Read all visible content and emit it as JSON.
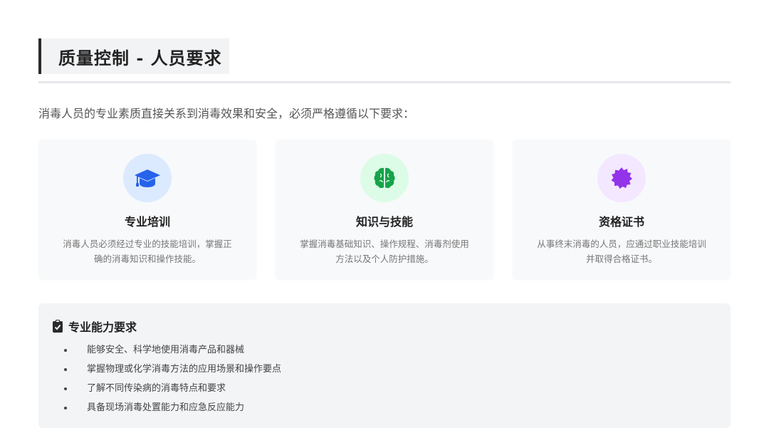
{
  "page": {
    "title": "质量控制 - 人员要求",
    "intro": "消毒人员的专业素质直接关系到消毒效果和安全，必须严格遵循以下要求："
  },
  "cards": [
    {
      "icon": "graduation-cap-icon",
      "icon_color": "#2563eb",
      "icon_bg": "#dbeafe",
      "title": "专业培训",
      "desc_line1": "消毒人员必须经过专业的技能培训，掌握正",
      "desc_line2": "确的消毒知识和操作技能。"
    },
    {
      "icon": "brain-icon",
      "icon_color": "#16a34a",
      "icon_bg": "#dcfce7",
      "title": "知识与技能",
      "desc_line1": "掌握消毒基础知识、操作规程、消毒剂使用",
      "desc_line2": "方法以及个人防护措施。"
    },
    {
      "icon": "certificate-badge-icon",
      "icon_color": "#9333ea",
      "icon_bg": "#f3e8ff",
      "title": "资格证书",
      "desc_line1": "从事终末消毒的人员，应通过职业技能培训",
      "desc_line2": "并取得合格证书。"
    }
  ],
  "requirements": {
    "icon": "clipboard-check-icon",
    "title": "专业能力要求",
    "items": [
      "能够安全、科学地使用消毒产品和器械",
      "掌握物理或化学消毒方法的应用场景和操作要点",
      "了解不同传染病的消毒特点和要求",
      "具备现场消毒处置能力和应急反应能力"
    ]
  }
}
